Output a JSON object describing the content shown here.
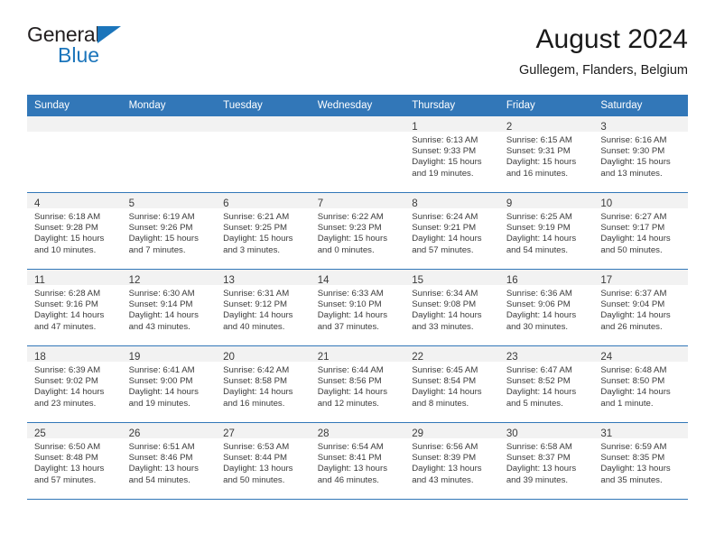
{
  "brand": {
    "line1": "General",
    "line2": "Blue",
    "icon": "triangle-logo"
  },
  "header": {
    "title": "August 2024",
    "subtitle": "Gullegem, Flanders, Belgium"
  },
  "colors": {
    "header_blue": "#3277b8",
    "brand_blue": "#1b75bb",
    "daynum_band": "#f2f2f2",
    "text": "#3b3b3b"
  },
  "weekday_headers": [
    "Sunday",
    "Monday",
    "Tuesday",
    "Wednesday",
    "Thursday",
    "Friday",
    "Saturday"
  ],
  "weeks": [
    [
      {
        "day": "",
        "sunrise": "",
        "sunset": "",
        "daylight1": "",
        "daylight2": ""
      },
      {
        "day": "",
        "sunrise": "",
        "sunset": "",
        "daylight1": "",
        "daylight2": ""
      },
      {
        "day": "",
        "sunrise": "",
        "sunset": "",
        "daylight1": "",
        "daylight2": ""
      },
      {
        "day": "",
        "sunrise": "",
        "sunset": "",
        "daylight1": "",
        "daylight2": ""
      },
      {
        "day": "1",
        "sunrise": "Sunrise: 6:13 AM",
        "sunset": "Sunset: 9:33 PM",
        "daylight1": "Daylight: 15 hours",
        "daylight2": "and 19 minutes."
      },
      {
        "day": "2",
        "sunrise": "Sunrise: 6:15 AM",
        "sunset": "Sunset: 9:31 PM",
        "daylight1": "Daylight: 15 hours",
        "daylight2": "and 16 minutes."
      },
      {
        "day": "3",
        "sunrise": "Sunrise: 6:16 AM",
        "sunset": "Sunset: 9:30 PM",
        "daylight1": "Daylight: 15 hours",
        "daylight2": "and 13 minutes."
      }
    ],
    [
      {
        "day": "4",
        "sunrise": "Sunrise: 6:18 AM",
        "sunset": "Sunset: 9:28 PM",
        "daylight1": "Daylight: 15 hours",
        "daylight2": "and 10 minutes."
      },
      {
        "day": "5",
        "sunrise": "Sunrise: 6:19 AM",
        "sunset": "Sunset: 9:26 PM",
        "daylight1": "Daylight: 15 hours",
        "daylight2": "and 7 minutes."
      },
      {
        "day": "6",
        "sunrise": "Sunrise: 6:21 AM",
        "sunset": "Sunset: 9:25 PM",
        "daylight1": "Daylight: 15 hours",
        "daylight2": "and 3 minutes."
      },
      {
        "day": "7",
        "sunrise": "Sunrise: 6:22 AM",
        "sunset": "Sunset: 9:23 PM",
        "daylight1": "Daylight: 15 hours",
        "daylight2": "and 0 minutes."
      },
      {
        "day": "8",
        "sunrise": "Sunrise: 6:24 AM",
        "sunset": "Sunset: 9:21 PM",
        "daylight1": "Daylight: 14 hours",
        "daylight2": "and 57 minutes."
      },
      {
        "day": "9",
        "sunrise": "Sunrise: 6:25 AM",
        "sunset": "Sunset: 9:19 PM",
        "daylight1": "Daylight: 14 hours",
        "daylight2": "and 54 minutes."
      },
      {
        "day": "10",
        "sunrise": "Sunrise: 6:27 AM",
        "sunset": "Sunset: 9:17 PM",
        "daylight1": "Daylight: 14 hours",
        "daylight2": "and 50 minutes."
      }
    ],
    [
      {
        "day": "11",
        "sunrise": "Sunrise: 6:28 AM",
        "sunset": "Sunset: 9:16 PM",
        "daylight1": "Daylight: 14 hours",
        "daylight2": "and 47 minutes."
      },
      {
        "day": "12",
        "sunrise": "Sunrise: 6:30 AM",
        "sunset": "Sunset: 9:14 PM",
        "daylight1": "Daylight: 14 hours",
        "daylight2": "and 43 minutes."
      },
      {
        "day": "13",
        "sunrise": "Sunrise: 6:31 AM",
        "sunset": "Sunset: 9:12 PM",
        "daylight1": "Daylight: 14 hours",
        "daylight2": "and 40 minutes."
      },
      {
        "day": "14",
        "sunrise": "Sunrise: 6:33 AM",
        "sunset": "Sunset: 9:10 PM",
        "daylight1": "Daylight: 14 hours",
        "daylight2": "and 37 minutes."
      },
      {
        "day": "15",
        "sunrise": "Sunrise: 6:34 AM",
        "sunset": "Sunset: 9:08 PM",
        "daylight1": "Daylight: 14 hours",
        "daylight2": "and 33 minutes."
      },
      {
        "day": "16",
        "sunrise": "Sunrise: 6:36 AM",
        "sunset": "Sunset: 9:06 PM",
        "daylight1": "Daylight: 14 hours",
        "daylight2": "and 30 minutes."
      },
      {
        "day": "17",
        "sunrise": "Sunrise: 6:37 AM",
        "sunset": "Sunset: 9:04 PM",
        "daylight1": "Daylight: 14 hours",
        "daylight2": "and 26 minutes."
      }
    ],
    [
      {
        "day": "18",
        "sunrise": "Sunrise: 6:39 AM",
        "sunset": "Sunset: 9:02 PM",
        "daylight1": "Daylight: 14 hours",
        "daylight2": "and 23 minutes."
      },
      {
        "day": "19",
        "sunrise": "Sunrise: 6:41 AM",
        "sunset": "Sunset: 9:00 PM",
        "daylight1": "Daylight: 14 hours",
        "daylight2": "and 19 minutes."
      },
      {
        "day": "20",
        "sunrise": "Sunrise: 6:42 AM",
        "sunset": "Sunset: 8:58 PM",
        "daylight1": "Daylight: 14 hours",
        "daylight2": "and 16 minutes."
      },
      {
        "day": "21",
        "sunrise": "Sunrise: 6:44 AM",
        "sunset": "Sunset: 8:56 PM",
        "daylight1": "Daylight: 14 hours",
        "daylight2": "and 12 minutes."
      },
      {
        "day": "22",
        "sunrise": "Sunrise: 6:45 AM",
        "sunset": "Sunset: 8:54 PM",
        "daylight1": "Daylight: 14 hours",
        "daylight2": "and 8 minutes."
      },
      {
        "day": "23",
        "sunrise": "Sunrise: 6:47 AM",
        "sunset": "Sunset: 8:52 PM",
        "daylight1": "Daylight: 14 hours",
        "daylight2": "and 5 minutes."
      },
      {
        "day": "24",
        "sunrise": "Sunrise: 6:48 AM",
        "sunset": "Sunset: 8:50 PM",
        "daylight1": "Daylight: 14 hours",
        "daylight2": "and 1 minute."
      }
    ],
    [
      {
        "day": "25",
        "sunrise": "Sunrise: 6:50 AM",
        "sunset": "Sunset: 8:48 PM",
        "daylight1": "Daylight: 13 hours",
        "daylight2": "and 57 minutes."
      },
      {
        "day": "26",
        "sunrise": "Sunrise: 6:51 AM",
        "sunset": "Sunset: 8:46 PM",
        "daylight1": "Daylight: 13 hours",
        "daylight2": "and 54 minutes."
      },
      {
        "day": "27",
        "sunrise": "Sunrise: 6:53 AM",
        "sunset": "Sunset: 8:44 PM",
        "daylight1": "Daylight: 13 hours",
        "daylight2": "and 50 minutes."
      },
      {
        "day": "28",
        "sunrise": "Sunrise: 6:54 AM",
        "sunset": "Sunset: 8:41 PM",
        "daylight1": "Daylight: 13 hours",
        "daylight2": "and 46 minutes."
      },
      {
        "day": "29",
        "sunrise": "Sunrise: 6:56 AM",
        "sunset": "Sunset: 8:39 PM",
        "daylight1": "Daylight: 13 hours",
        "daylight2": "and 43 minutes."
      },
      {
        "day": "30",
        "sunrise": "Sunrise: 6:58 AM",
        "sunset": "Sunset: 8:37 PM",
        "daylight1": "Daylight: 13 hours",
        "daylight2": "and 39 minutes."
      },
      {
        "day": "31",
        "sunrise": "Sunrise: 6:59 AM",
        "sunset": "Sunset: 8:35 PM",
        "daylight1": "Daylight: 13 hours",
        "daylight2": "and 35 minutes."
      }
    ]
  ]
}
